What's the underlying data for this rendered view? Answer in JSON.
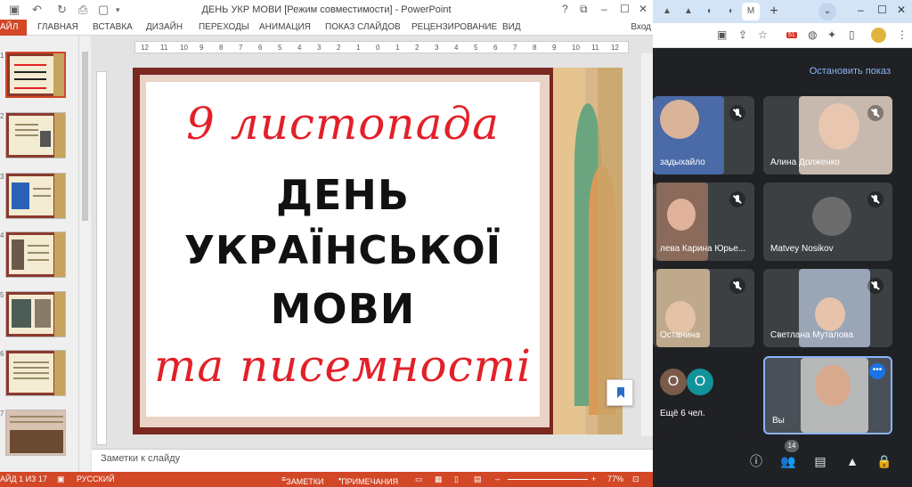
{
  "ppt": {
    "title": "ДЕНЬ УКР МОВИ [Режим совместимости] - PowerPoint",
    "window_buttons": [
      "?",
      "⧉",
      "–",
      "☐",
      "✕"
    ],
    "ribbon_tabs": [
      "АЙЛ",
      "ГЛАВНАЯ",
      "ВСТАВКА",
      "ДИЗАЙН",
      "ПЕРЕХОДЫ",
      "АНИМАЦИЯ",
      "ПОКАЗ СЛАЙДОВ",
      "РЕЦЕНЗИРОВАНИЕ",
      "ВИД"
    ],
    "sign_in": "Вход",
    "thumb_numbers": [
      "1",
      "2",
      "3",
      "4",
      "5",
      "6",
      "7"
    ],
    "ruler": [
      "12",
      "11",
      "10",
      "9",
      "8",
      "7",
      "6",
      "5",
      "4",
      "3",
      "2",
      "1",
      "0",
      "1",
      "2",
      "3",
      "4",
      "5",
      "6",
      "7",
      "8",
      "9",
      "10",
      "11",
      "12"
    ],
    "slide": {
      "line1": "9 листопада",
      "line2": "ДЕНЬ",
      "line3": "УКРАЇНСЬКОЇ",
      "line4": "МОВИ",
      "line5": "та писемності"
    },
    "notes_placeholder": "Заметки к слайду",
    "status": {
      "slide": "АЙД 1 ИЗ 17",
      "language": "РУССКИЙ",
      "notes": "ЗАМЕТКИ",
      "comments": "ПРИМЕЧАНИЯ",
      "zoom": "77%"
    },
    "colors": {
      "accent": "#d24726",
      "slide_red": "#e32028"
    }
  },
  "browser": {
    "tab_letter": "М",
    "toolbar_badge": "51",
    "meet": {
      "stop_presenting": "Остановить показ",
      "participants": [
        {
          "name": "задыхайло"
        },
        {
          "name": "Алина Долженко"
        },
        {
          "name": "лева Карина Юрье..."
        },
        {
          "name": "Matvey Nosikov"
        },
        {
          "name": "Останина"
        },
        {
          "name": "Светлана Муталова"
        }
      ],
      "others_circles": [
        "О",
        "О"
      ],
      "others_label": "Ещё 6 чел.",
      "self_label": "Вы",
      "people_count": "14"
    }
  }
}
